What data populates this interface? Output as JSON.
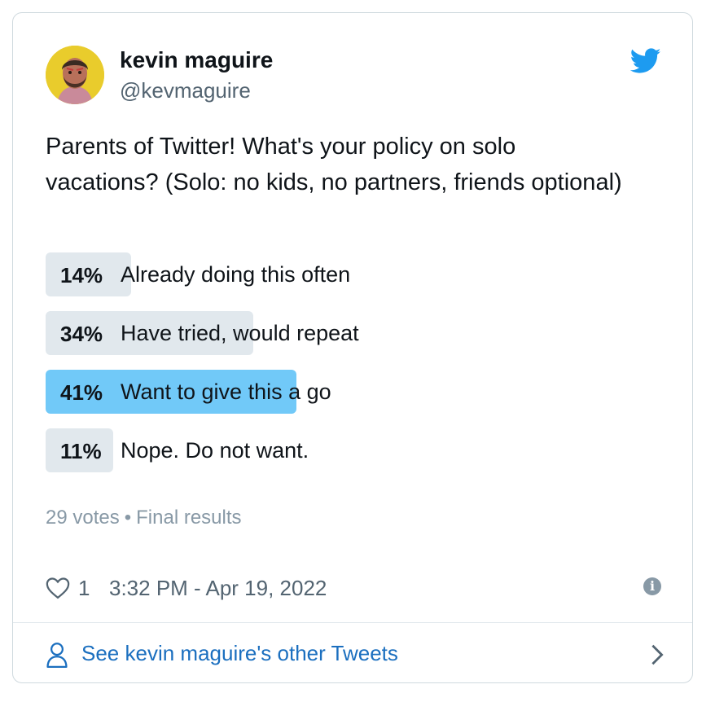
{
  "author": {
    "name": "kevin maguire",
    "handle": "@kevmaguire"
  },
  "tweet": {
    "text": "Parents of Twitter! What's your policy on solo vacations? (Solo: no kids, no partners, friends optional)"
  },
  "poll": {
    "options": [
      {
        "pct_label": "14%",
        "percent": 14,
        "label": "Already doing this often",
        "winner": false
      },
      {
        "pct_label": "34%",
        "percent": 34,
        "label": "Have tried, would repeat",
        "winner": false
      },
      {
        "pct_label": "41%",
        "percent": 41,
        "label": "Want to give this a go",
        "winner": true
      },
      {
        "pct_label": "11%",
        "percent": 11,
        "label": "Nope. Do not want.",
        "winner": false
      }
    ],
    "votes": "29 votes",
    "separator": "•",
    "status": "Final results"
  },
  "footer": {
    "likes": "1",
    "timestamp": "3:32 PM - Apr 19, 2022",
    "info_icon": "info-icon"
  },
  "other_tweets": {
    "label": "See kevin maguire's other Tweets"
  },
  "colors": {
    "winner_bar": "#71c9f8",
    "bar": "#e1e8ed",
    "link": "#1b6fbf",
    "twitter_blue": "#1d9bf0"
  }
}
